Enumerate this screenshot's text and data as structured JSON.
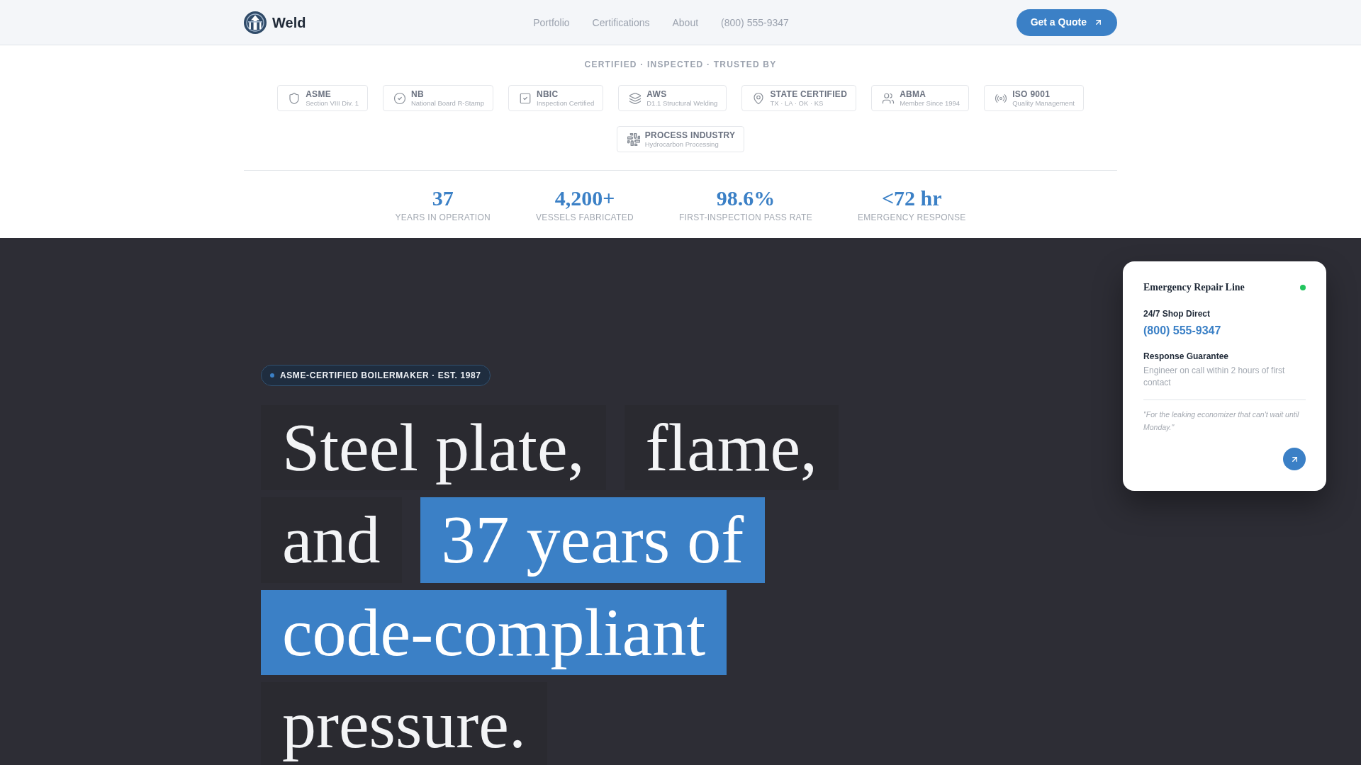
{
  "nav": {
    "brand": "Weld",
    "links": [
      "Portfolio",
      "Certifications",
      "About",
      "(800) 555-9347"
    ],
    "cta": "Get a Quote"
  },
  "certifications": {
    "heading": "CERTIFIED · INSPECTED · TRUSTED BY",
    "badges": [
      {
        "title": "ASME",
        "subtitle": "Section VIII Div. 1"
      },
      {
        "title": "NB",
        "subtitle": "National Board R-Stamp"
      },
      {
        "title": "NBIC",
        "subtitle": "Inspection Certified"
      },
      {
        "title": "AWS",
        "subtitle": "D1.1 Structural Welding"
      },
      {
        "title": "STATE CERTIFIED",
        "subtitle": "TX · LA · OK · KS"
      },
      {
        "title": "ABMA",
        "subtitle": "Member Since 1994"
      },
      {
        "title": "ISO 9001",
        "subtitle": "Quality Management"
      },
      {
        "title": "PROCESS INDUSTRY",
        "subtitle": "Hydrocarbon Processing"
      }
    ]
  },
  "stats": [
    {
      "value": "37",
      "label": "YEARS IN OPERATION"
    },
    {
      "value": "4,200+",
      "label": "VESSELS FABRICATED"
    },
    {
      "value": "98.6%",
      "label": "FIRST-INSPECTION PASS RATE"
    },
    {
      "value": "<72 hr",
      "label": "EMERGENCY RESPONSE"
    }
  ],
  "hero": {
    "tagline": "ASME-CERTIFIED BOILERMAKER · EST. 1987",
    "headline": [
      {
        "text": "Steel plate,",
        "highlighted": false
      },
      {
        "text": "flame,",
        "highlighted": false
      },
      {
        "text": "and",
        "highlighted": false
      },
      {
        "text": "37 years of",
        "highlighted": true
      },
      {
        "text": "code-compliant",
        "highlighted": true
      },
      {
        "text": "pressure.",
        "highlighted": false
      }
    ]
  },
  "emergency_card": {
    "title": "Emergency Repair Line",
    "online": true,
    "sections": [
      {
        "kind": "phone",
        "label": "24/7 Shop Direct",
        "value": "(800) 555-9347"
      },
      {
        "kind": "text",
        "label": "Response Guarantee",
        "value": "Engineer on call within 2 hours of first contact"
      }
    ],
    "quote": "\"For the leaking economizer that can't wait until Monday.\""
  }
}
